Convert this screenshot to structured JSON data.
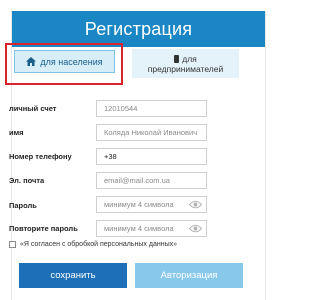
{
  "header": {
    "title": "Регистрация"
  },
  "tabs": {
    "individuals": {
      "label": "для населения",
      "icon": "home-icon"
    },
    "business": {
      "label_line1": "для",
      "label_line2": "предпринимателей",
      "icon": "phone-icon"
    }
  },
  "form": {
    "account": {
      "label": "личный счет",
      "placeholder": "12010544"
    },
    "name": {
      "label": "имя",
      "placeholder": "Коляда Николай Иванович"
    },
    "phone": {
      "label": "Номер телефону",
      "value": "+38"
    },
    "email": {
      "label": "Эл. почта",
      "placeholder": "email@mail.com.ua"
    },
    "password": {
      "label": "Пароль",
      "placeholder": "минимум 4 символа"
    },
    "password_repeat": {
      "label": "Повторите пароль",
      "placeholder": "минимум 4 символа"
    }
  },
  "consent": {
    "label": "«Я согласен с обробкой персональных данных»"
  },
  "buttons": {
    "save": "сохранить",
    "login": "Авторизация"
  },
  "colors": {
    "accent": "#1a86c4",
    "highlight": "#d8232a",
    "primary_button": "#1d6fb8",
    "secondary_button": "#88c8ea"
  }
}
